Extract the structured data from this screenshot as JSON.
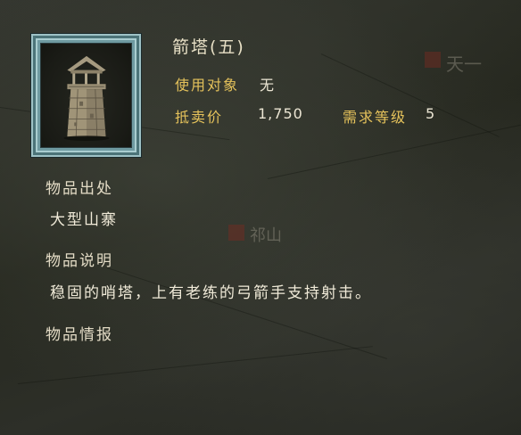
{
  "item": {
    "name": "箭塔(五)",
    "icon": "watchtower-icon",
    "use_target": {
      "label": "使用对象",
      "value": "无"
    },
    "sell_price": {
      "label": "抵卖价",
      "value": "1,750"
    },
    "level_req": {
      "label": "需求等级",
      "value": "5"
    }
  },
  "sections": {
    "origin": {
      "heading": "物品出处",
      "value": "大型山寨"
    },
    "description": {
      "heading": "物品说明",
      "value": "稳固的哨塔，上有老练的弓箭手支持射击。"
    },
    "intel": {
      "heading": "物品情报"
    }
  },
  "background": {
    "watermark_top_right": "天一",
    "watermark_center": "祁山"
  },
  "colors": {
    "gold_label": "#e5c25b",
    "text_light": "#ece6d4",
    "frame_teal": "#6f9aa1"
  }
}
